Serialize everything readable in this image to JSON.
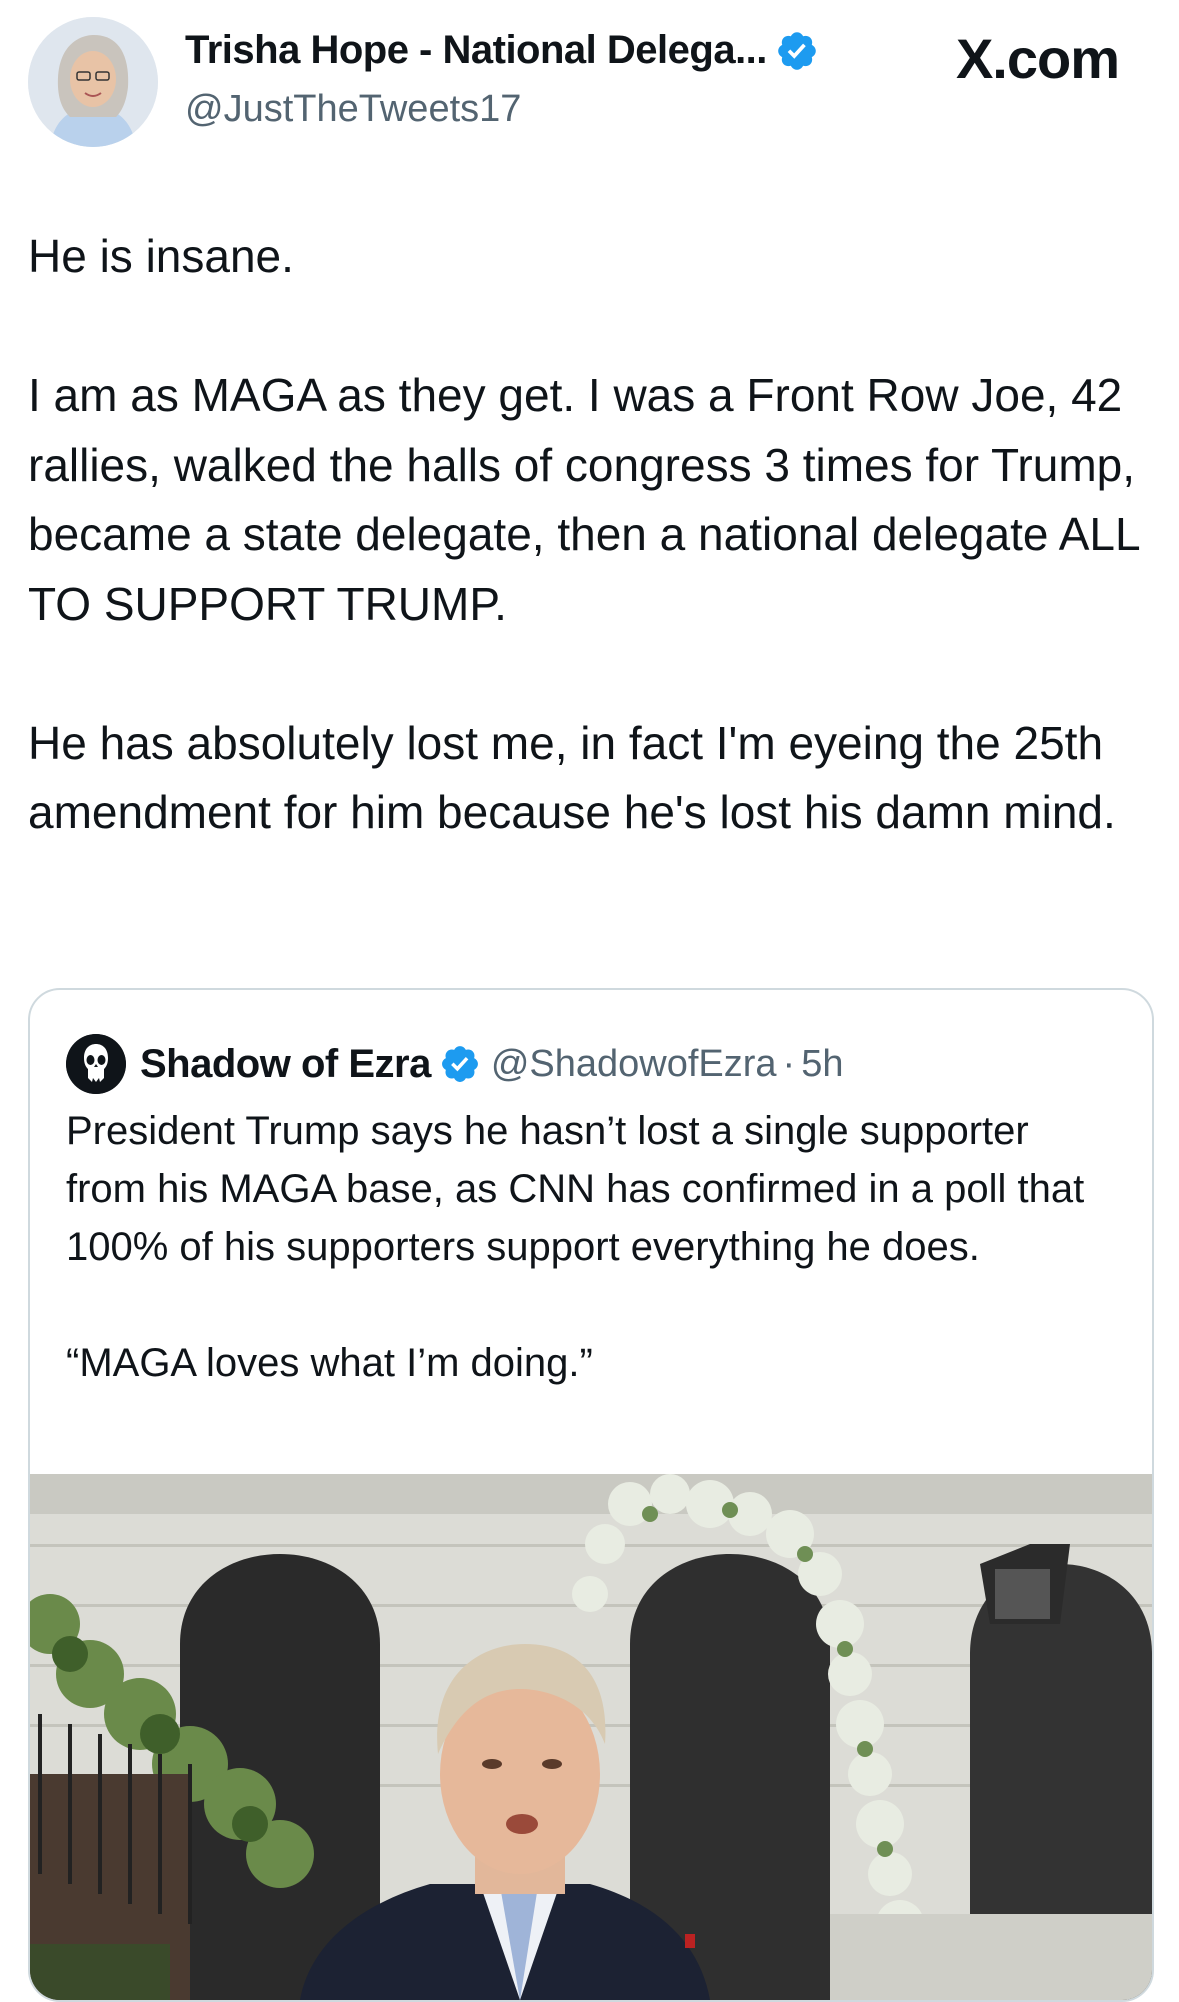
{
  "header": {
    "display_name": "Trisha Hope - National Delega...",
    "handle": "@JustTheTweets17",
    "brand": "X.com"
  },
  "tweet": {
    "paragraphs": [
      "He is insane.",
      "I am as MAGA as they get.  I was a Front Row Joe, 42 rallies, walked the halls of congress 3 times for Trump, became a state delegate, then a national delegate ALL TO SUPPORT TRUMP.",
      "He has absolutely lost me, in fact I'm eyeing the 25th amendment for him because he's lost his damn mind."
    ]
  },
  "quoted": {
    "display_name": "Shadow of Ezra",
    "handle": "@ShadowofEzra",
    "separator": "·",
    "time": "5h",
    "paragraphs": [
      "President Trump says he hasn’t lost a single supporter from his MAGA base, as CNN has confirmed in a poll that 100% of his supporters support everything he does.",
      "“MAGA loves what I’m doing.”"
    ]
  },
  "colors": {
    "text": "#0f1419",
    "secondary": "#536471",
    "verified": "#1d9bf0",
    "border": "#cfd9de"
  },
  "icons": {
    "verified": "verified-badge-icon",
    "brand": "x-logo-icon",
    "quoted_avatar": "punisher-skull-avatar"
  }
}
